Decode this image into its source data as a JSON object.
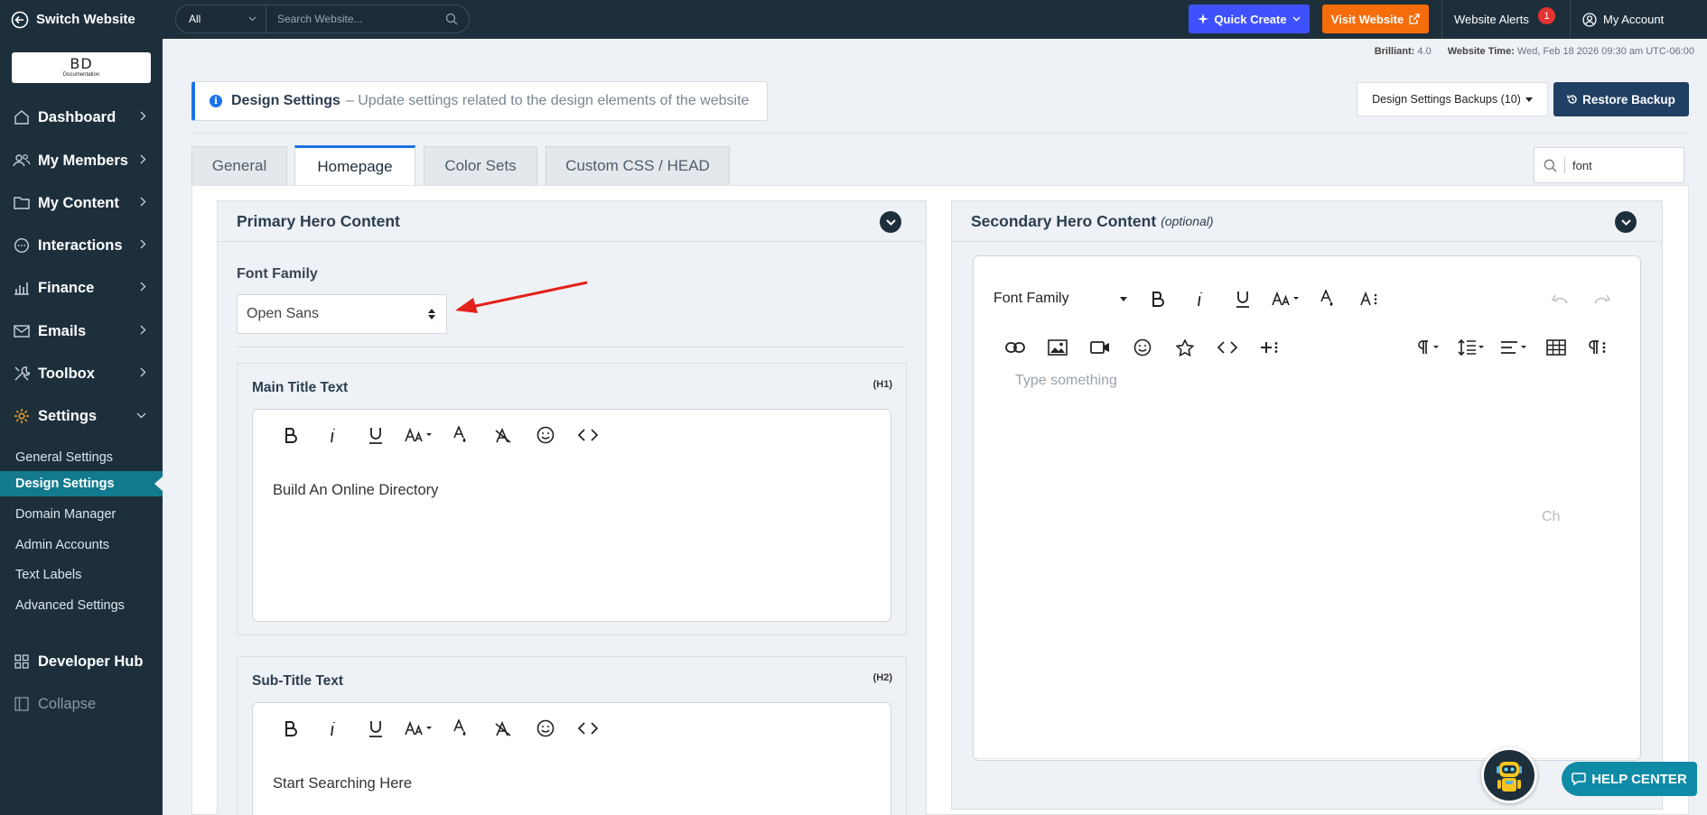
{
  "topbar": {
    "switch_label": "Switch Website",
    "scope": "All",
    "search_placeholder": "Search Website...",
    "quick_create": "Quick Create",
    "visit_website": "Visit Website",
    "alerts_label": "Website Alerts",
    "alerts_count": "1",
    "account_label": "My Account"
  },
  "logo": {
    "main": "BD",
    "sub": "Documentation"
  },
  "sidebar": {
    "nav": [
      "Dashboard",
      "My Members",
      "My Content",
      "Interactions",
      "Finance",
      "Emails",
      "Toolbox",
      "Settings"
    ],
    "sub": [
      "General Settings",
      "Design Settings",
      "Domain Manager",
      "Admin Accounts",
      "Text Labels",
      "Advanced Settings"
    ],
    "dev_hub": "Developer Hub",
    "collapse": "Collapse"
  },
  "meta": {
    "version_label": "Brilliant:",
    "version": "4.0",
    "time_label": "Website Time:",
    "time": "Wed, Feb 18 2026 09:30 am UTC-06:00"
  },
  "info": {
    "title": "Design Settings",
    "desc": "– Update settings related to the design elements of the website"
  },
  "backups_label": "Design Settings Backups (10)",
  "restore_label": "Restore Backup",
  "tabs": [
    "General",
    "Homepage",
    "Color Sets",
    "Custom CSS / HEAD"
  ],
  "field_search_value": "font",
  "primary": {
    "title": "Primary Hero Content",
    "font_family_label": "Font Family",
    "font_family_value": "Open Sans",
    "main_title_label": "Main Title Text",
    "main_title_tag": "(H1)",
    "main_title_value": "Build An Online Directory",
    "subtitle_label": "Sub-Title Text",
    "subtitle_tag": "(H2)",
    "subtitle_value": "Start Searching Here"
  },
  "secondary": {
    "title": "Secondary Hero Content",
    "optional": "(optional)",
    "font_family_label": "Font Family",
    "placeholder": "Type something",
    "char_counter": "Ch"
  },
  "help_center": "HELP CENTER",
  "colors": {
    "sidebar": "#1e2f3c",
    "active": "#137a8e",
    "quick_create": "#3f51ff",
    "visit": "#f56c0b",
    "restore": "#1f3f63",
    "help": "#0f8ba8"
  }
}
